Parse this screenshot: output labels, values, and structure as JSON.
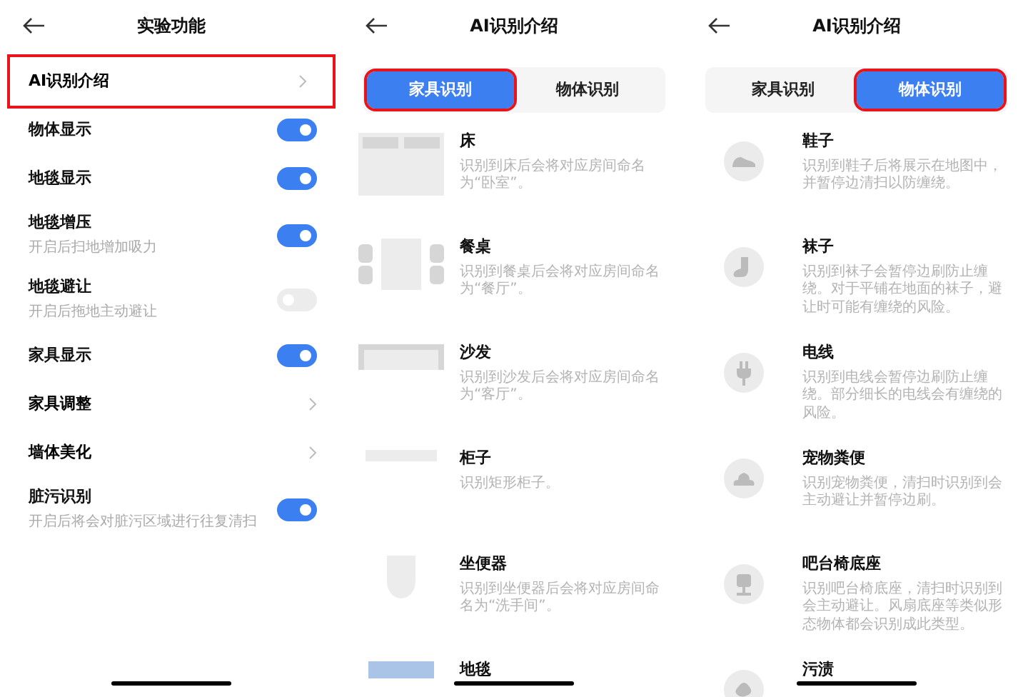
{
  "screens": [
    {
      "title": "实验功能",
      "rows": [
        {
          "kind": "link",
          "label": "AI识别介绍",
          "highlighted": true
        },
        {
          "kind": "toggle",
          "label": "物体显示",
          "on": true
        },
        {
          "kind": "toggle",
          "label": "地毯显示",
          "on": true
        },
        {
          "kind": "toggle",
          "label": "地毯增压",
          "hint": "开启后扫地增加吸力",
          "on": true
        },
        {
          "kind": "toggle",
          "label": "地毯避让",
          "hint": "开启后拖地主动避让",
          "on": false
        },
        {
          "kind": "toggle",
          "label": "家具显示",
          "on": true
        },
        {
          "kind": "link",
          "label": "家具调整",
          "highlighted": false
        },
        {
          "kind": "link",
          "label": "墙体美化",
          "highlighted": false
        },
        {
          "kind": "toggle",
          "label": "脏污识别",
          "hint": "开启后将会对脏污区域进行往复清扫",
          "on": true
        }
      ]
    },
    {
      "title": "AI识别介绍",
      "tabs": [
        {
          "label": "家具识别",
          "selected": true,
          "highlighted": true
        },
        {
          "label": "物体识别",
          "selected": false,
          "highlighted": false
        }
      ],
      "items": [
        {
          "name": "床",
          "description": "识别到床后会将对应房间命名为“卧室”。"
        },
        {
          "name": "餐桌",
          "description": "识别到餐桌后会将对应房间命名为“餐厅”。"
        },
        {
          "name": "沙发",
          "description": "识别到沙发后会将对应房间命名为“客厅”。"
        },
        {
          "name": "柜子",
          "description": "识别矩形柜子。"
        },
        {
          "name": "坐便器",
          "description": "识别到坐便器后会将对应房间命名为“洗手间”。"
        },
        {
          "name": "地毯"
        }
      ]
    },
    {
      "title": "AI识别介绍",
      "tabs": [
        {
          "label": "家具识别",
          "selected": false,
          "highlighted": false
        },
        {
          "label": "物体识别",
          "selected": true,
          "highlighted": true
        }
      ],
      "items": [
        {
          "name": "鞋子",
          "description": "识别到鞋子后将展示在地图中，并暂停边清扫以防缠绕。"
        },
        {
          "name": "袜子",
          "description": "识别到袜子会暂停边刷防止缠绕。对于平铺在地面的袜子，避让时可能有缠绕的风险。"
        },
        {
          "name": "电线",
          "description": "识别到电线会暂停边刷防止缠绕。部分细长的电线会有缠绕的风险。"
        },
        {
          "name": "宠物粪便",
          "description": "识别宠物粪便，清扫时识别到会主动避让并暂停边刷。"
        },
        {
          "name": "吧台椅底座",
          "description": "识别吧台椅底座，清扫时识别到会主动避让。风扇底座等类似形态物体都会识别成此类型。"
        },
        {
          "name": "污渍"
        }
      ]
    }
  ]
}
